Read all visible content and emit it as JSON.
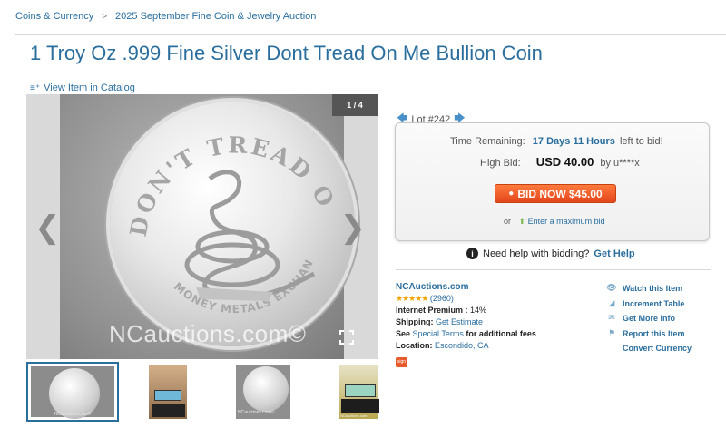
{
  "breadcrumb": {
    "items": [
      "Coins & Currency",
      "2025 September Fine Coin & Jewelry Auction"
    ],
    "separator": ">"
  },
  "title": "1 Troy Oz .999 Fine Silver Dont Tread On Me Bullion Coin",
  "catalog_link": "View Item in Catalog",
  "gallery": {
    "counter": "1 / 4",
    "watermark": "NCauctions.com©",
    "coin_top_text": "DON'T TREAD ON ME",
    "coin_bottom_text": "MONEY METALS EXCHANGE",
    "prev_arrow": "❮",
    "next_arrow": "❯",
    "thumbnails": [
      {
        "label": "NCauctions.com©"
      },
      {
        "label": ""
      },
      {
        "label": "NCauctions.com©"
      },
      {
        "label": "NCauctions.com"
      }
    ]
  },
  "lot": {
    "label": "Lot #242",
    "prev_icon": "🡄",
    "next_icon": "🡆"
  },
  "bid_box": {
    "time_label": "Time Remaining:",
    "time_value": "17 Days 11 Hours",
    "time_suffix": "left to bid!",
    "high_label": "High Bid:",
    "high_amount": "USD 40.00",
    "high_by": "by u****x",
    "bid_button": "BID NOW $45.00",
    "max_prefix": "or",
    "max_link": "Enter a maximum bid"
  },
  "help": {
    "text": "Need help with bidding?",
    "link": "Get Help"
  },
  "seller": {
    "name": "NCAuctions.com",
    "stars": "★★★★★",
    "rating_count": "(2960)",
    "premium_label": "Internet Premium :",
    "premium_value": "14%",
    "shipping_label": "Shipping:",
    "shipping_value": "Get Estimate",
    "terms_prefix": "See",
    "terms_link": "Special Terms",
    "terms_suffix": "for additional fees",
    "location_label": "Location:",
    "location_value": "Escondido, CA",
    "badge": "sign"
  },
  "actions": [
    {
      "icon": "eye-icon",
      "glyph": "👁",
      "label": "Watch this Item"
    },
    {
      "icon": "increment-icon",
      "glyph": "◢",
      "label": "Increment Table"
    },
    {
      "icon": "mail-icon",
      "glyph": "✉",
      "label": "Get More Info"
    },
    {
      "icon": "flag-icon",
      "glyph": "⚑",
      "label": "Report this Item"
    },
    {
      "icon": "",
      "glyph": "",
      "label": "Convert Currency"
    }
  ],
  "colors": {
    "link": "#2a6e9e",
    "bid_button": "#e3461b",
    "stars": "#f2a500"
  }
}
